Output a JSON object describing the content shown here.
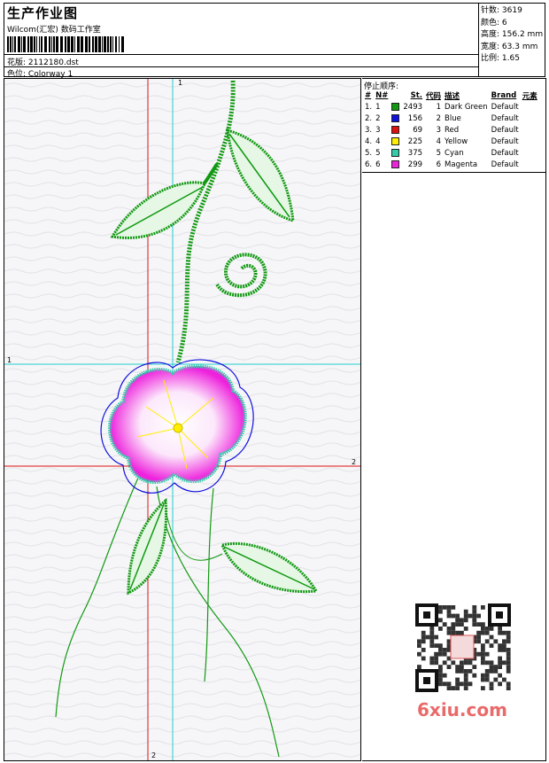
{
  "header": {
    "title": "生产作业图",
    "company": "Wilcom(汇宏) 数码工作室",
    "design_label": "花版:",
    "design_value": "2112180.dst",
    "colorway_label": "色位:",
    "colorway_value": "Colorway 1"
  },
  "stats": [
    {
      "label": "针数:",
      "value": "3619"
    },
    {
      "label": "颜色:",
      "value": "6"
    },
    {
      "label": "高度:",
      "value": "156.2 mm"
    },
    {
      "label": "宽度:",
      "value": "63.3 mm"
    },
    {
      "label": "比例:",
      "value": "1.65"
    }
  ],
  "panel": {
    "heading": "停止顺序:",
    "columns": [
      "#",
      "N#",
      "St.",
      "代码",
      "描述",
      "Brand",
      "元素"
    ],
    "rows": [
      {
        "idx": "1.",
        "n": "1",
        "color": "#119911",
        "st": "2493",
        "code": "1",
        "desc": "Dark Green",
        "brand": "Default"
      },
      {
        "idx": "2.",
        "n": "2",
        "color": "#1111dd",
        "st": "156",
        "code": "2",
        "desc": "Blue",
        "brand": "Default"
      },
      {
        "idx": "3.",
        "n": "3",
        "color": "#dd1111",
        "st": "69",
        "code": "3",
        "desc": "Red",
        "brand": "Default"
      },
      {
        "idx": "4.",
        "n": "4",
        "color": "#ffee00",
        "st": "225",
        "code": "4",
        "desc": "Yellow",
        "brand": "Default"
      },
      {
        "idx": "5.",
        "n": "5",
        "color": "#33ccaa",
        "st": "375",
        "code": "5",
        "desc": "Cyan",
        "brand": "Default"
      },
      {
        "idx": "6.",
        "n": "6",
        "color": "#ee22dd",
        "st": "299",
        "code": "6",
        "desc": "Magenta",
        "brand": "Default"
      }
    ]
  },
  "guides": {
    "cyan_v": "1",
    "cyan_h": "1",
    "red_h": "2",
    "red_v": "2"
  },
  "watermark": "6xiu.com",
  "colors": {
    "green": "#119911",
    "blue": "#1111dd",
    "red": "#dd1111",
    "yellow": "#ffee00",
    "cyan": "#33ccaa",
    "magenta": "#ee22dd"
  }
}
